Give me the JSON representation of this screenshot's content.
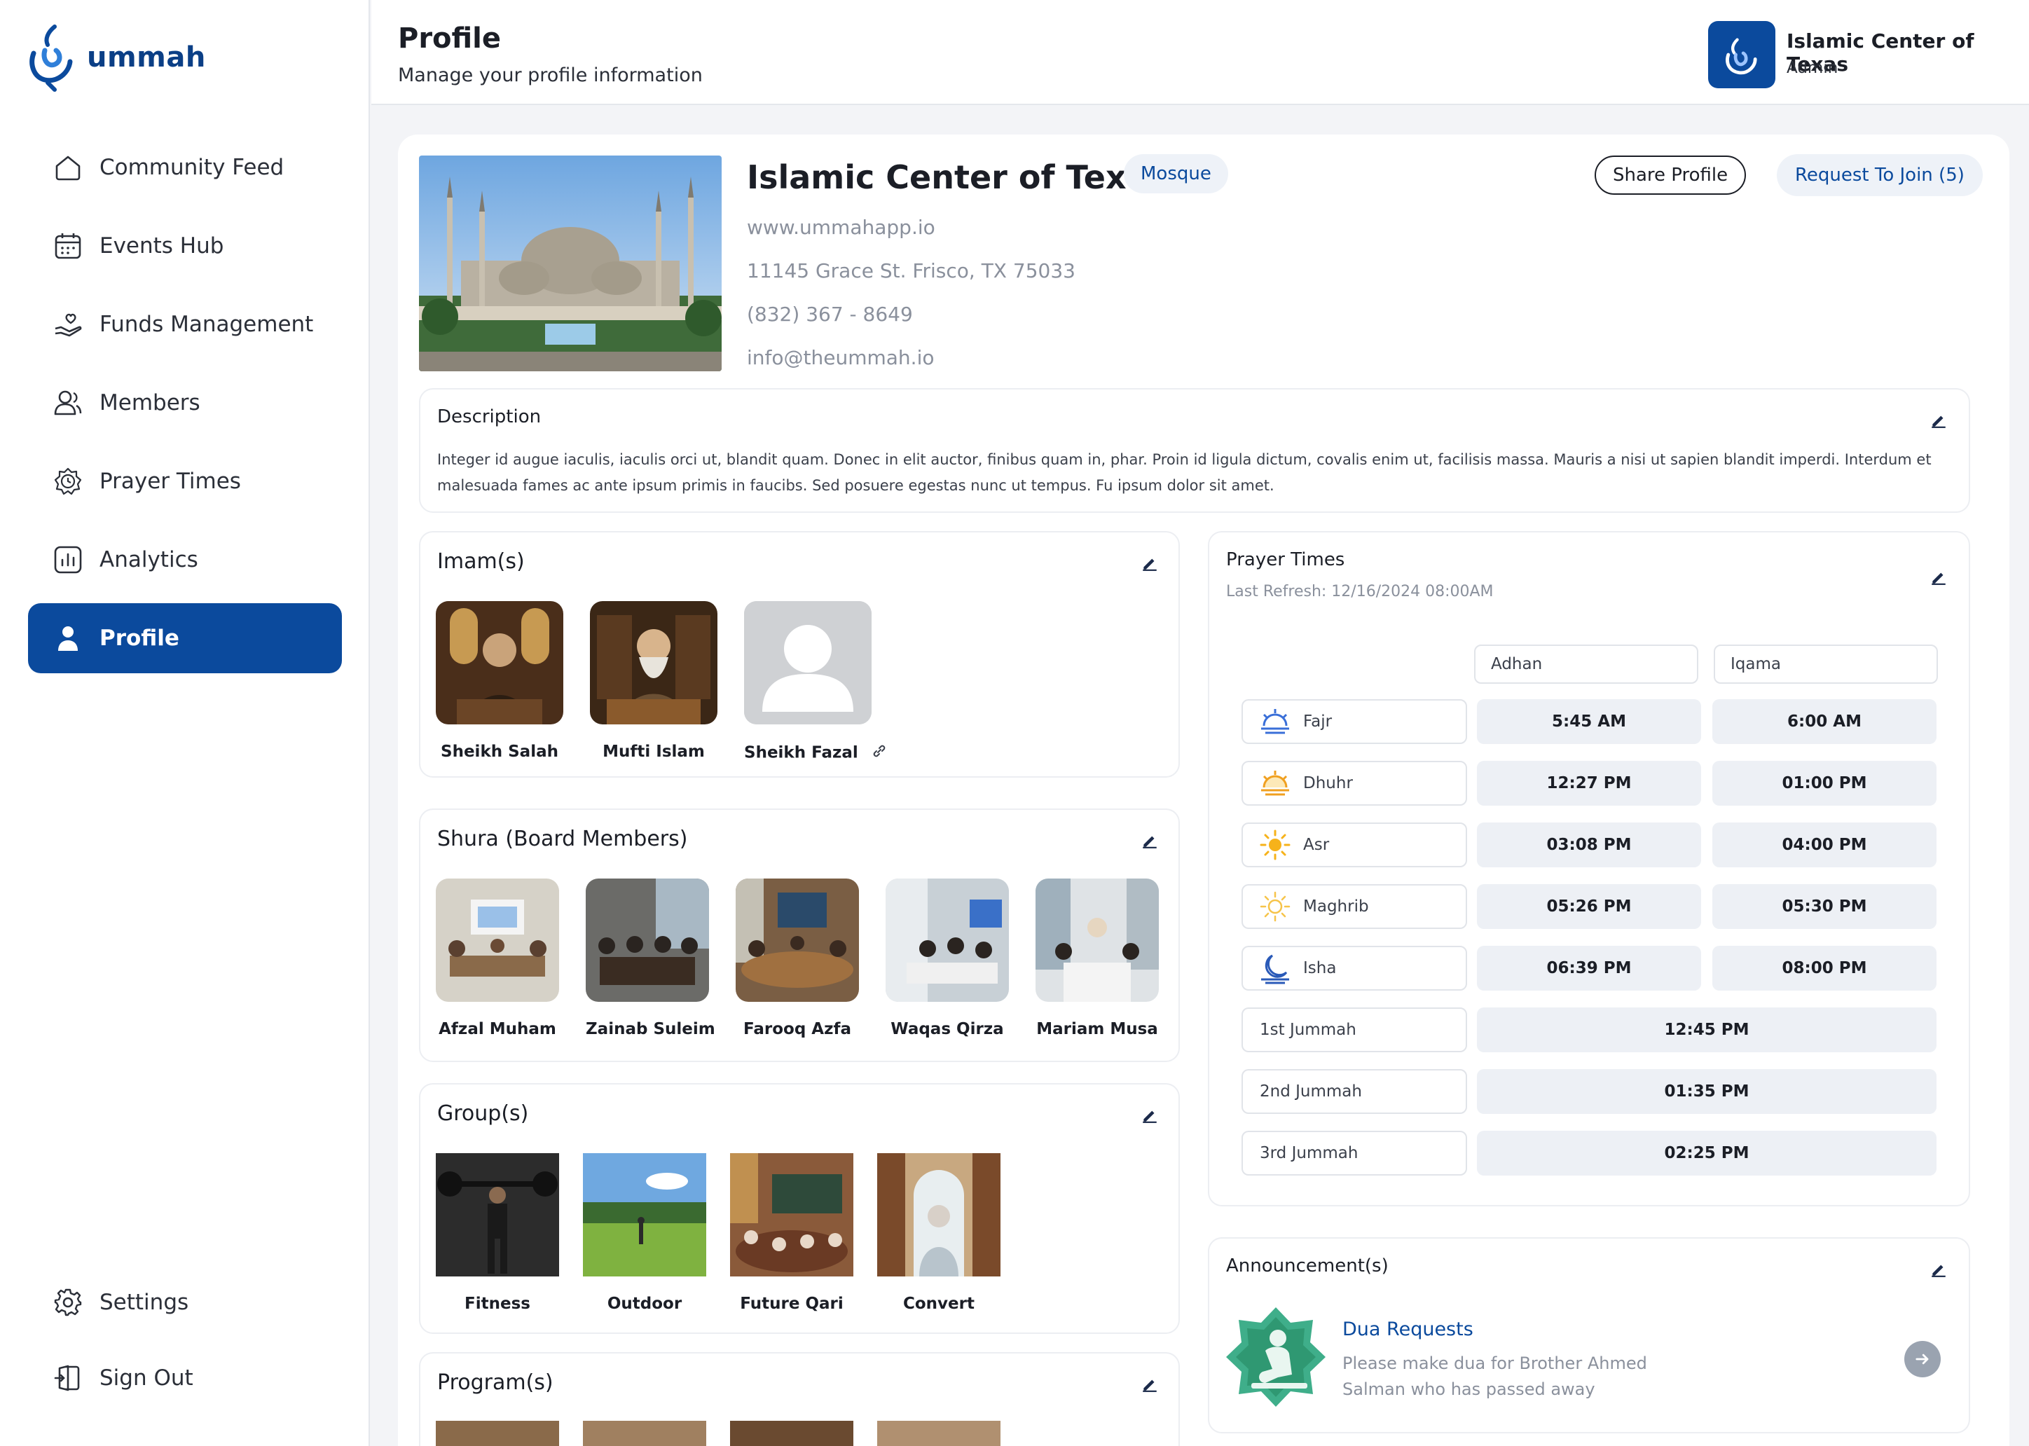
{
  "app": {
    "name": "ummah"
  },
  "sidebar": {
    "items": [
      {
        "label": "Community Feed",
        "icon": "home-icon"
      },
      {
        "label": "Events Hub",
        "icon": "calendar-icon"
      },
      {
        "label": "Funds Management",
        "icon": "hand-heart-icon"
      },
      {
        "label": "Members",
        "icon": "users-icon"
      },
      {
        "label": "Prayer Times",
        "icon": "clock-icon"
      },
      {
        "label": "Analytics",
        "icon": "chart-icon"
      },
      {
        "label": "Profile",
        "icon": "user-icon",
        "active": true
      }
    ],
    "bottom": [
      {
        "label": "Settings",
        "icon": "gear-icon"
      },
      {
        "label": "Sign Out",
        "icon": "sign-out-icon"
      }
    ]
  },
  "header": {
    "title": "Profile",
    "subtitle": "Manage your profile information",
    "account_name": "Islamic Center of Texas",
    "account_role": "Admin"
  },
  "profile": {
    "name": "Islamic Center of Texas",
    "type": "Mosque",
    "share_label": "Share Profile",
    "join_label": "Request To Join (5)",
    "website": "www.ummahapp.io",
    "address": "11145 Grace St. Frisco, TX 75033",
    "phone": "(832) 367 - 8649",
    "email": "info@theummah.io"
  },
  "description": {
    "title": "Description",
    "text": "Integer id augue iaculis, iaculis orci ut, blandit quam. Donec in elit auctor, finibus quam in, phar. Proin id ligula dictum, covalis enim ut, facilisis massa. Mauris a nisi ut sapien blandit imperdi. Interdum et malesuada fames ac ante ipsum primis in faucibs. Sed posuere egestas nunc ut tempus. Fu ipsum dolor sit amet."
  },
  "imams": {
    "title": "Imam(s)",
    "people": [
      "Sheikh Salah",
      "Mufti Islam",
      "Sheikh Fazal"
    ]
  },
  "shura": {
    "title": "Shura (Board Members)",
    "people": [
      "Afzal Muham",
      "Zainab Suleim",
      "Farooq Azfa",
      "Waqas Qirza",
      "Mariam Musa"
    ]
  },
  "groups": {
    "title": "Group(s)",
    "items": [
      "Fitness",
      "Outdoor",
      "Future Qari",
      "Convert"
    ]
  },
  "programs": {
    "title": "Program(s)"
  },
  "prayer_times": {
    "title": "Prayer Times",
    "last_refresh": "Last Refresh: 12/16/2024 08:00AM",
    "col_adhan": "Adhan",
    "col_iqama": "Iqama",
    "rows": [
      {
        "name": "Fajr",
        "adhan": "5:45 AM",
        "iqama": "6:00 AM",
        "icon": "sunrise-icon"
      },
      {
        "name": "Dhuhr",
        "adhan": "12:27 PM",
        "iqama": "01:00 PM",
        "icon": "sun-horizon-icon"
      },
      {
        "name": "Asr",
        "adhan": "03:08 PM",
        "iqama": "04:00 PM",
        "icon": "sun-icon"
      },
      {
        "name": "Maghrib",
        "adhan": "05:26 PM",
        "iqama": "05:30 PM",
        "icon": "sun-outline-icon"
      },
      {
        "name": "Isha",
        "adhan": "06:39 PM",
        "iqama": "08:00 PM",
        "icon": "moon-icon"
      }
    ],
    "jummah": [
      {
        "name": "1st Jummah",
        "time": "12:45 PM"
      },
      {
        "name": "2nd Jummah",
        "time": "01:35 PM"
      },
      {
        "name": "3rd Jummah",
        "time": "02:25 PM"
      }
    ]
  },
  "announcements": {
    "title": "Announcement(s)",
    "item_title": "Dua Requests",
    "item_body": "Please make dua for Brother Ahmed Salman who has passed away"
  },
  "colors": {
    "brand": "#0b4a9d",
    "pill_bg": "#eef2f8",
    "muted": "#8a909c"
  }
}
